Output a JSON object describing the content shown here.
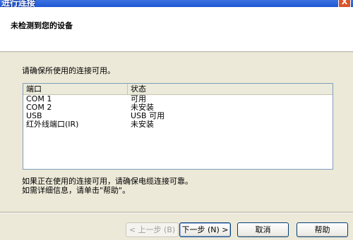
{
  "window": {
    "title": "进行连接",
    "close_label": "X"
  },
  "header": {
    "heading": "未检测到您的设备"
  },
  "main": {
    "instruction": "请确保所使用的连接可用。",
    "table": {
      "columns": [
        "端口",
        "状态"
      ],
      "rows": [
        {
          "port": "COM 1",
          "status": "可用"
        },
        {
          "port": "COM 2",
          "status": "未安装"
        },
        {
          "port": "USB",
          "status": "USB 可用"
        },
        {
          "port": "红外线端口(IR)",
          "status": "未安装"
        }
      ]
    },
    "note_line1": "如果正在使用的连接可用，请确保电缆连接可靠。",
    "note_line2": "如需详细信息，请单击\"帮助\"。"
  },
  "buttons": {
    "back": "< 上一步 (B)",
    "next": "下一步 (N) >",
    "cancel": "取消",
    "help": "帮助"
  },
  "colors": {
    "titlebar": "#1f57d6",
    "dialog_bg": "#ece9d8",
    "header_bg": "#ffffff"
  }
}
